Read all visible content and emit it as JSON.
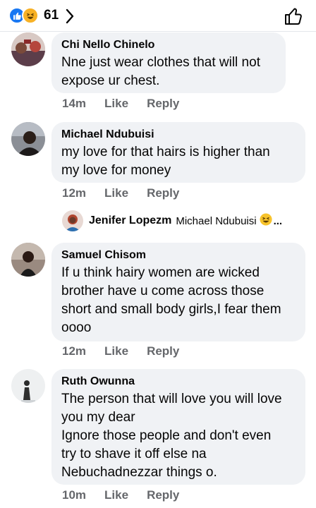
{
  "header": {
    "reaction_count": "61",
    "icons": [
      "like-reaction-icon",
      "haha-reaction-icon",
      "chevron-right-icon",
      "thumbs-up-icon"
    ],
    "colors": {
      "like": "#1877f2",
      "haha": "#f7b125"
    }
  },
  "comments": [
    {
      "author": "Chi Nello Chinelo",
      "lines": [
        "Nne just wear clothes that will not",
        "expose ur chest."
      ],
      "time": "14m",
      "like_label": "Like",
      "reply_label": "Reply"
    },
    {
      "author": "Michael Ndubuisi",
      "lines": [
        "my love for that hairs is higher than",
        "my love for money"
      ],
      "time": "12m",
      "like_label": "Like",
      "reply_label": "Reply"
    },
    {
      "author": "Samuel Chisom",
      "lines": [
        "If u think hairy women are wicked",
        "brother have u come across those",
        "short and small body girls,I fear them",
        "oooo"
      ],
      "time": "12m",
      "like_label": "Like",
      "reply_label": "Reply"
    },
    {
      "author": "Ruth Owunna",
      "lines": [
        "The person that will love you will love",
        "you my dear",
        "Ignore those people and don't even",
        "try to shave it off else na",
        "Nebuchadnezzar things o."
      ],
      "time": "10m",
      "like_label": "Like",
      "reply_label": "Reply"
    }
  ],
  "reply_preview": {
    "author": "Jenifer Lopezm",
    "snippet": "Michael Ndubuisi",
    "ellipsis": "..."
  },
  "theme": {
    "bubble": "#f0f2f5",
    "muted": "#65676b"
  }
}
